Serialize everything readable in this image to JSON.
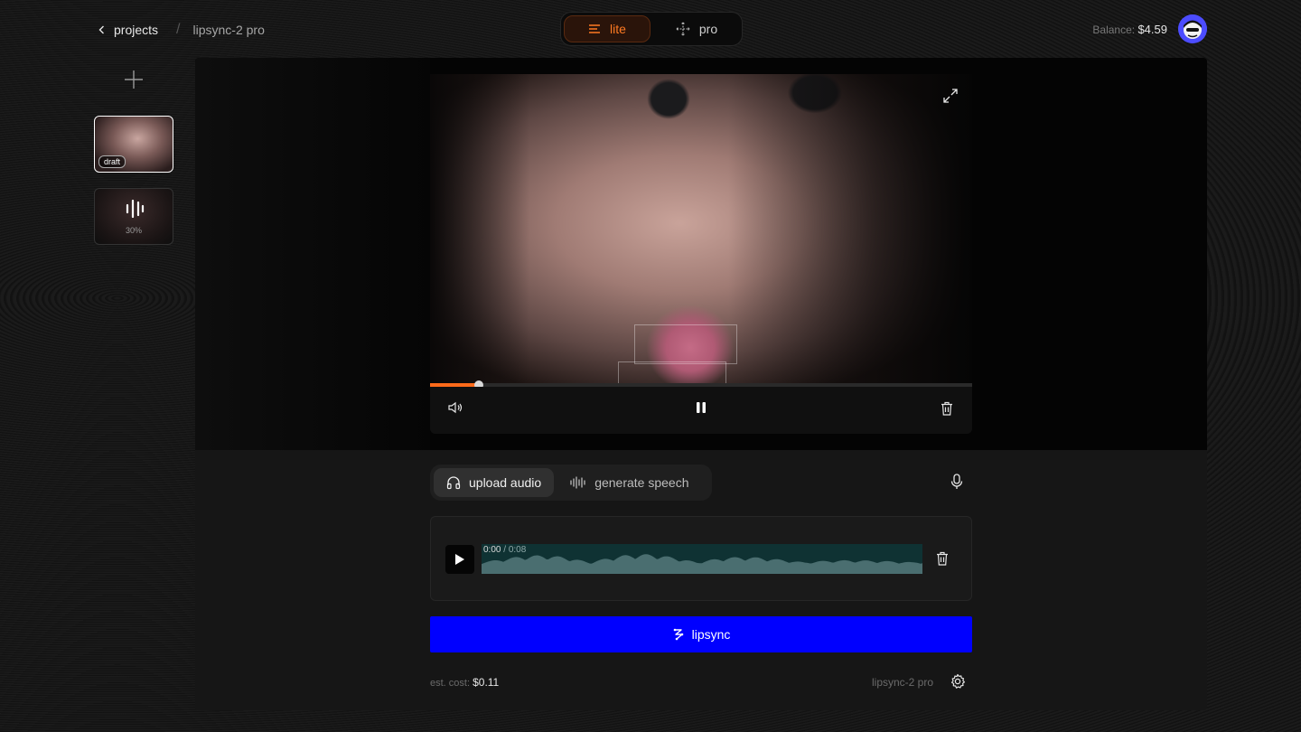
{
  "breadcrumb": {
    "projects": "projects",
    "model": "lipsync-2 pro"
  },
  "mode_switch": {
    "lite": "lite",
    "pro": "pro",
    "active": "lite"
  },
  "balance": {
    "label": "Balance:",
    "value": "$4.59"
  },
  "sidebar": {
    "items": [
      {
        "badge": "draft"
      },
      {
        "progress_label": "30%"
      }
    ]
  },
  "player": {
    "progress": 0.09
  },
  "audio_tabs": {
    "upload": "upload audio",
    "generate": "generate speech",
    "active": "upload"
  },
  "audio_clip": {
    "current": "0:00",
    "separator": " / ",
    "duration": "0:08"
  },
  "actions": {
    "lipsync_label": "lipsync"
  },
  "footer": {
    "cost_label": "est. cost:",
    "cost_value": "$0.11",
    "model": "lipsync-2 pro"
  },
  "colors": {
    "accent": "#ff7a22",
    "primary_button": "#0000ff",
    "waveform": "#4a6e70"
  },
  "icons": [
    "chevron-left-icon",
    "menu-lines-icon",
    "move-icon",
    "plus-icon",
    "waveform-bars-icon",
    "expand-icon",
    "volume-icon",
    "pause-icon",
    "trash-icon",
    "headphones-icon",
    "audio-wave-icon",
    "mic-icon",
    "play-icon",
    "sync-icon",
    "gear-icon"
  ]
}
